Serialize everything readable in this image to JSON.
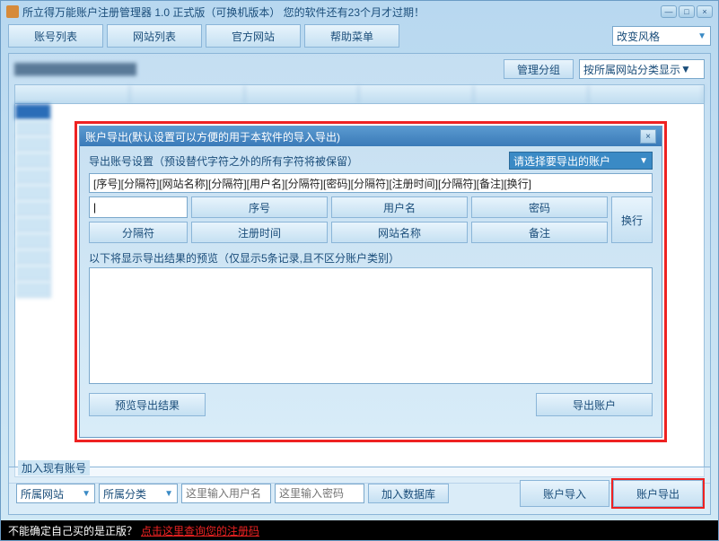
{
  "title": "所立得万能账户注册管理器 1.0  正式版（可换机版本） 您的软件还有23个月才过期！",
  "win": {
    "min": "—",
    "max": "□",
    "close": "×"
  },
  "tabs": [
    "账号列表",
    "网站列表",
    "官方网站",
    "帮助菜单"
  ],
  "style_select": "改变风格",
  "manage_group": "管理分组",
  "sort_by": "按所属网站分类显示",
  "bottom": {
    "legend": "加入现有账号",
    "site": "所属网站",
    "cat": "所属分类",
    "user_ph": "这里输入用户名",
    "pass_ph": "这里输入密码",
    "add_db": "加入数据库",
    "import": "账户导入",
    "export": "账户导出"
  },
  "status": {
    "text": "不能确定自己买的是正版？",
    "link": "点击这里查询您的注册码"
  },
  "dialog": {
    "title": "账户导出(默认设置可以方便的用于本软件的导入导出)",
    "export_setting": "导出账号设置（预设替代字符之外的所有字符将被保留）",
    "select_accounts": "请选择要导出的账户",
    "format": "[序号][分隔符][网站名称][分隔符][用户名][分隔符][密码][分隔符][注册时间][分隔符][备注][换行]",
    "sep_input": "|",
    "tokens": {
      "seq": "序号",
      "user": "用户名",
      "pass": "密码",
      "sep": "分隔符",
      "regtime": "注册时间",
      "site": "网站名称",
      "remark": "备注",
      "wrap": "换行"
    },
    "preview_label": "以下将显示导出结果的预览（仅显示5条记录,且不区分账户类别）",
    "preview_btn": "预览导出结果",
    "export_btn": "导出账户"
  }
}
